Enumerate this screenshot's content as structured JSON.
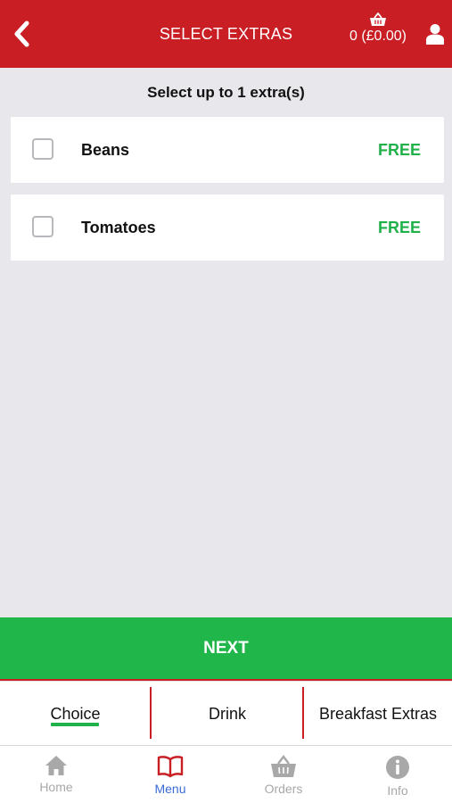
{
  "header": {
    "title": "SELECT EXTRAS",
    "cart_summary": "0 (£0.00)",
    "back_icon": "chevron-left-icon",
    "cart_icon": "basket-icon",
    "user_icon": "user-icon"
  },
  "main": {
    "instruction": "Select up to 1 extra(s)",
    "extras": [
      {
        "name": "Beans",
        "price": "FREE",
        "checked": false
      },
      {
        "name": "Tomatoes",
        "price": "FREE",
        "checked": false
      }
    ]
  },
  "next_button": {
    "label": "NEXT"
  },
  "category_tabs": [
    {
      "label": "Choice",
      "active": true
    },
    {
      "label": "Drink",
      "active": false
    },
    {
      "label": "Breakfast Extras",
      "active": false
    }
  ],
  "bottom_nav": [
    {
      "label": "Home",
      "icon": "home-icon",
      "active": false
    },
    {
      "label": "Menu",
      "icon": "book-icon",
      "active": true
    },
    {
      "label": "Orders",
      "icon": "basket-icon",
      "active": false
    },
    {
      "label": "Info",
      "icon": "info-icon",
      "active": false
    }
  ],
  "colors": {
    "brand_red": "#c81e24",
    "accent_green": "#21b64a",
    "active_nav_blue": "#3b6bd6",
    "background": "#e8e8ec"
  }
}
